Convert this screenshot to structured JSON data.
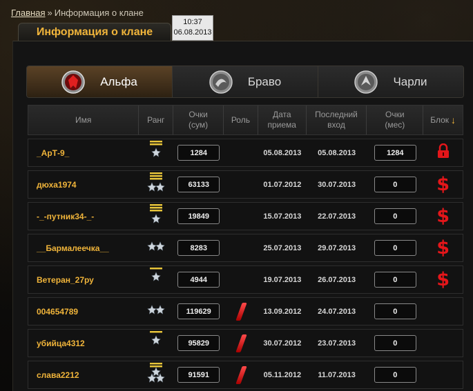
{
  "breadcrumb": {
    "home": "Главная",
    "separator": "»",
    "current": "Информация о клане"
  },
  "page_title": "Информация о клане",
  "datetime": {
    "time": "10:37",
    "date": "06.08.2013"
  },
  "tabs": [
    {
      "label": "Альфа",
      "active": true,
      "icon": "alpha-emblem-icon"
    },
    {
      "label": "Браво",
      "active": false,
      "icon": "bravo-emblem-icon"
    },
    {
      "label": "Чарли",
      "active": false,
      "icon": "charlie-emblem-icon"
    }
  ],
  "columns": {
    "name": "Имя",
    "rank": "Ранг",
    "points_total": "Очки (сум)",
    "role": "Роль",
    "join_date": "Дата приема",
    "last_login": "Последний вход",
    "points_month": "Очки (мес)",
    "block": "Блок"
  },
  "rows": [
    {
      "name": "_АрТ-9_",
      "rank_icon": "rank-2stripe-1star-icon",
      "points_total": "1284",
      "role": "",
      "join_date": "05.08.2013",
      "last_login": "05.08.2013",
      "points_month": "1284",
      "block": "lock-icon"
    },
    {
      "name": "дюха1974",
      "rank_icon": "rank-3stripe-2star-icon",
      "points_total": "63133",
      "role": "",
      "join_date": "01.07.2012",
      "last_login": "30.07.2013",
      "points_month": "0",
      "block": "dollar-icon",
      "block_text": "$"
    },
    {
      "name": "-_-путник34-_-",
      "rank_icon": "rank-3stripe-1star-icon",
      "points_total": "19849",
      "role": "",
      "join_date": "15.07.2013",
      "last_login": "22.07.2013",
      "points_month": "0",
      "block": "dollar-icon",
      "block_text": "$"
    },
    {
      "name": "__Бармалеечка__",
      "rank_icon": "rank-2star-icon",
      "points_total": "8283",
      "role": "",
      "join_date": "25.07.2013",
      "last_login": "29.07.2013",
      "points_month": "0",
      "block": "dollar-icon",
      "block_text": "$"
    },
    {
      "name": "Ветеран_27ру",
      "rank_icon": "rank-1stripe-1star-icon",
      "points_total": "4944",
      "role": "",
      "join_date": "19.07.2013",
      "last_login": "26.07.2013",
      "points_month": "0",
      "block": "dollar-icon",
      "block_text": "$"
    },
    {
      "name": "004654789",
      "rank_icon": "rank-2star-icon",
      "points_total": "119629",
      "role": "role-slash-icon",
      "join_date": "13.09.2012",
      "last_login": "24.07.2013",
      "points_month": "0",
      "block": ""
    },
    {
      "name": "убийца4312",
      "rank_icon": "rank-1stripe-1star-icon",
      "points_total": "95829",
      "role": "role-slash-icon",
      "join_date": "30.07.2012",
      "last_login": "23.07.2013",
      "points_month": "0",
      "block": ""
    },
    {
      "name": "слава2212",
      "rank_icon": "rank-2stripe-3star-icon",
      "points_total": "91591",
      "role": "role-slash-icon",
      "join_date": "05.11.2012",
      "last_login": "11.07.2013",
      "points_month": "0",
      "block": ""
    }
  ],
  "colors": {
    "accent": "#f0b43a",
    "danger": "#e4161a",
    "background": "#121212"
  }
}
